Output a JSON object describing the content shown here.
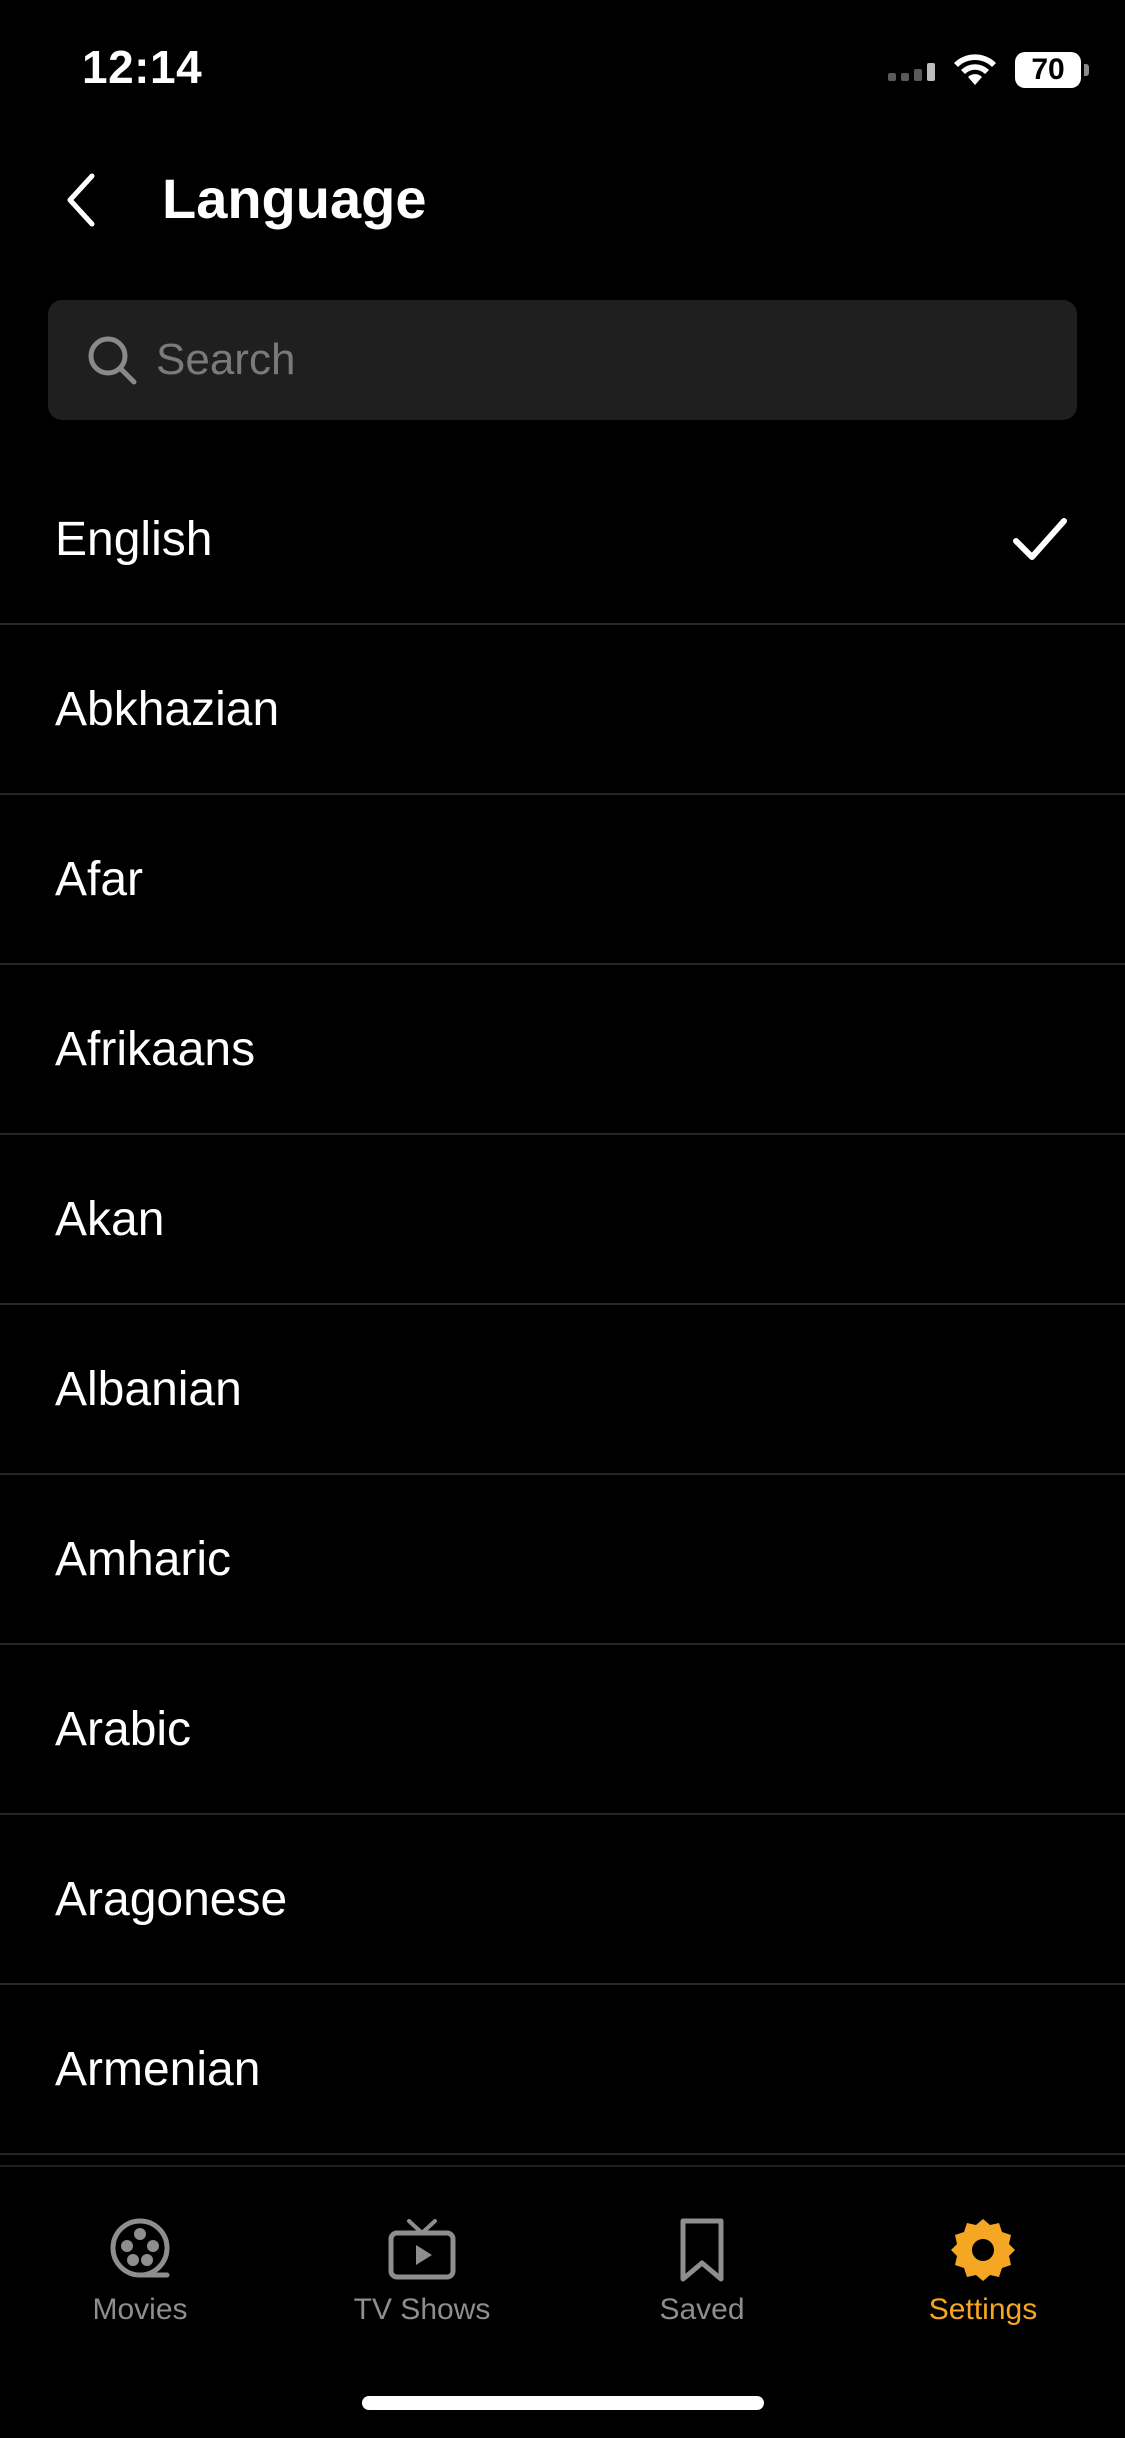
{
  "status_bar": {
    "time": "12:14",
    "battery": "70"
  },
  "header": {
    "title": "Language"
  },
  "search": {
    "placeholder": "Search"
  },
  "languages": [
    {
      "label": "English",
      "selected": true
    },
    {
      "label": "Abkhazian",
      "selected": false
    },
    {
      "label": "Afar",
      "selected": false
    },
    {
      "label": "Afrikaans",
      "selected": false
    },
    {
      "label": "Akan",
      "selected": false
    },
    {
      "label": "Albanian",
      "selected": false
    },
    {
      "label": "Amharic",
      "selected": false
    },
    {
      "label": "Arabic",
      "selected": false
    },
    {
      "label": "Aragonese",
      "selected": false
    },
    {
      "label": "Armenian",
      "selected": false
    }
  ],
  "tab_bar": {
    "tabs": [
      {
        "label": "Movies",
        "icon": "film-reel-icon",
        "active": false
      },
      {
        "label": "TV Shows",
        "icon": "tv-icon",
        "active": false
      },
      {
        "label": "Saved",
        "icon": "bookmark-icon",
        "active": false
      },
      {
        "label": "Settings",
        "icon": "gear-icon",
        "active": true
      }
    ]
  },
  "colors": {
    "background": "#000000",
    "accent": "#f5a623",
    "inactive_tab": "#8e8e8e",
    "search_bg": "#1f1f1f"
  }
}
